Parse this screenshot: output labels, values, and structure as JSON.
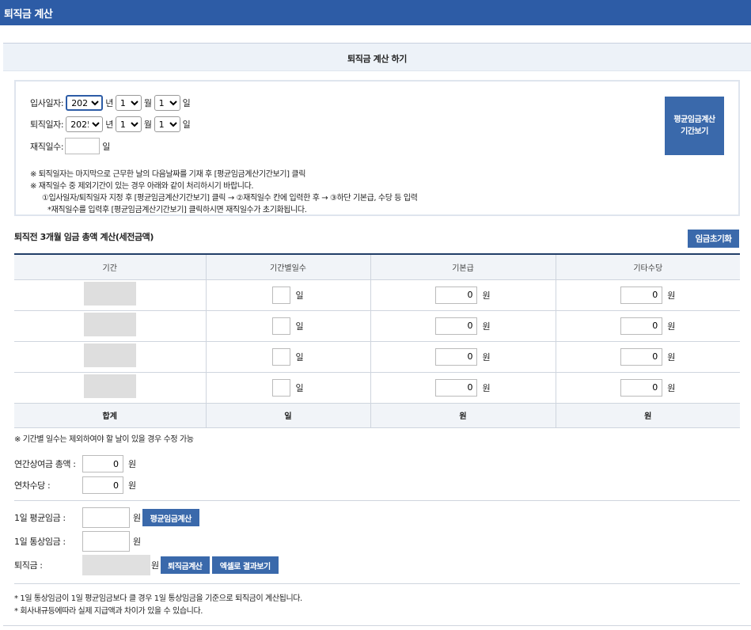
{
  "header": {
    "title": "퇴직금 계산"
  },
  "section": {
    "title": "퇴직금 계산 하기"
  },
  "dates": {
    "hire_label": "입사일자:",
    "retire_label": "퇴직일자:",
    "year": "2025",
    "month": "1",
    "day": "1",
    "unit_year": "년",
    "unit_month": "월",
    "unit_day": "일",
    "work_days_label": "재직일수:",
    "work_days_unit": "일",
    "period_button_line1": "평균임금계산",
    "period_button_line2": "기간보기"
  },
  "notes": {
    "n1": "※ 퇴직일자는 마지막으로 근무한 날의 다음날짜를 기재 후 [평균임금계산기간보기] 클릭",
    "n2": "※ 재직일수 중 제외기간이 있는 경우 아래와 같이 처리하시기 바랍니다.",
    "n3": "①입사일자/퇴직일자 지정 후 [평균임금계산기간보기] 클릭 → ②재직일수 칸에 입력한 후 → ③하단 기본급, 수당 등 입력",
    "n4": "*재직일수를 입력후 [평균임금계산기간보기] 클릭하시면 재직일수가 초기화됩니다."
  },
  "wage": {
    "title": "퇴직전 3개월 임금 총액 계산(세전금액)",
    "reset_button": "임금초기화",
    "columns": [
      "기간",
      "기간별일수",
      "기본급",
      "기타수당"
    ],
    "rows": [
      {
        "days": "",
        "base": "0",
        "other": "0"
      },
      {
        "days": "",
        "base": "0",
        "other": "0"
      },
      {
        "days": "",
        "base": "0",
        "other": "0"
      },
      {
        "days": "",
        "base": "0",
        "other": "0"
      }
    ],
    "unit_day": "일",
    "unit_won": "원",
    "total_label": "합계",
    "total_days": "일",
    "total_base": "원",
    "total_other": "원",
    "note": "※ 기간별 일수는 제외하여야 할 날이 있을 경우 수정 가능"
  },
  "bonus": {
    "annual_label": "연간상여금 총액 :",
    "annual_value": "0",
    "leave_label": "연차수당 :",
    "leave_value": "0",
    "unit": "원"
  },
  "result": {
    "avg_label": "1일 평균임금 :",
    "avg_value": "",
    "avg_button": "평균임금계산",
    "ordinary_label": "1일 통상임금 :",
    "ordinary_value": "",
    "severance_label": "퇴직금 :",
    "severance_value": "",
    "calc_button": "퇴직금계산",
    "excel_button": "엑셀로 결과보기",
    "unit": "원"
  },
  "footer": {
    "f1": "* 1일 통상임금이 1일 평균임금보다 클 경우 1일 통상임금을 기준으로 퇴직금이 계산됩니다.",
    "f2": "* 회사내규등에따라 실제 지급액과 차이가 있을 수 있습니다."
  }
}
